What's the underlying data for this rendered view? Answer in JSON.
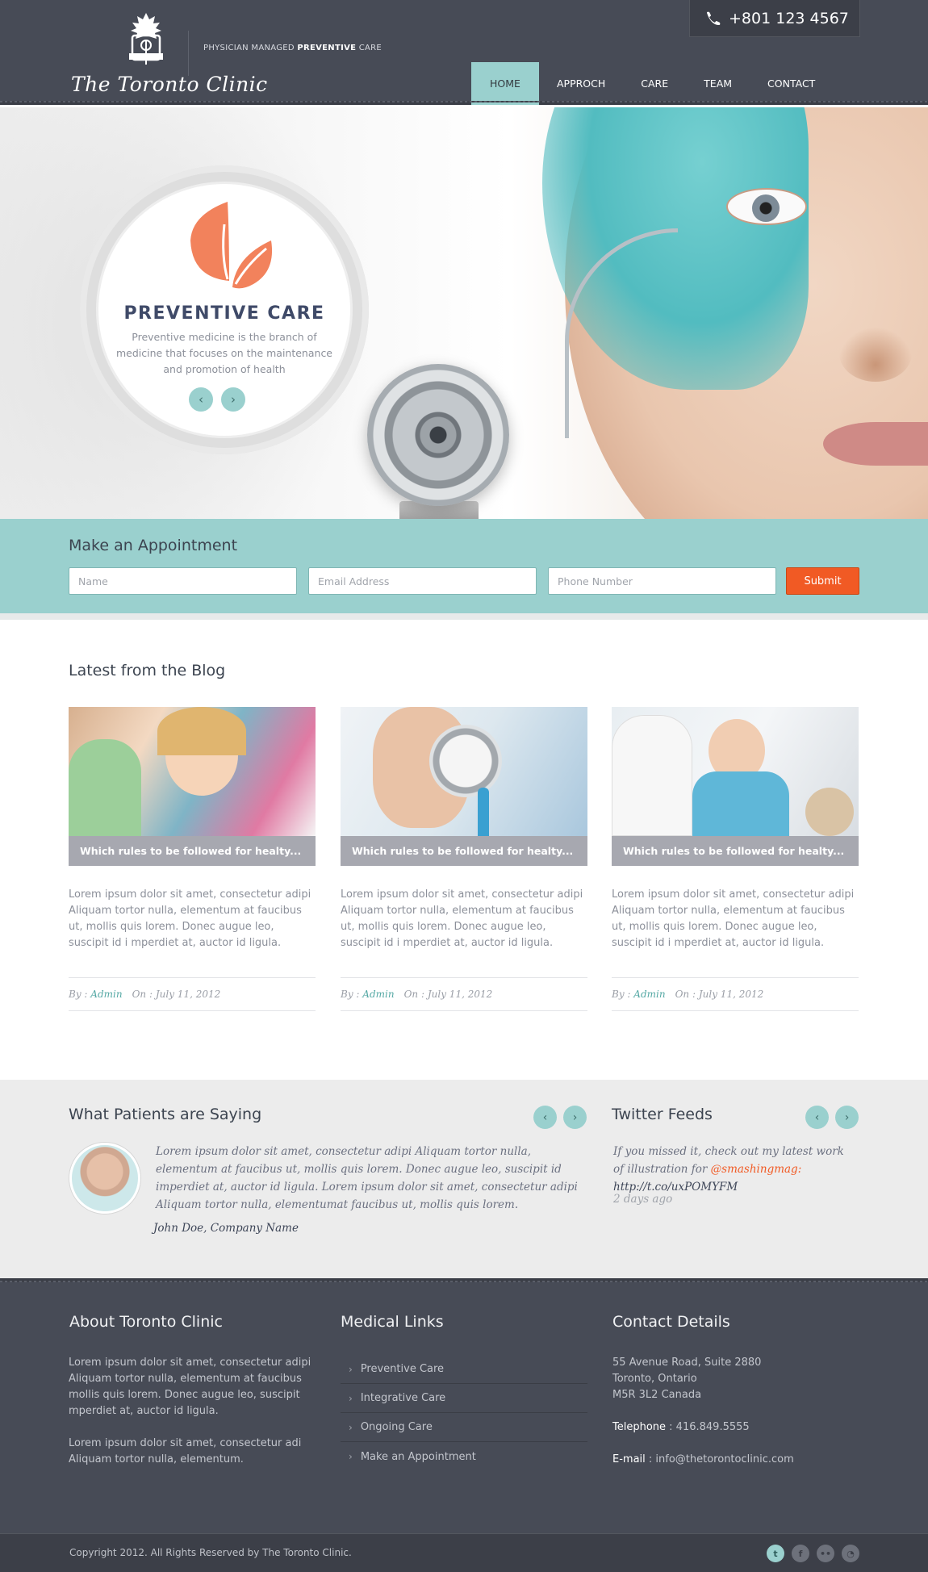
{
  "brand": {
    "logo_text": "The Toronto Clinic",
    "tagline_pre": "Physician managed ",
    "tagline_bold": "preventive",
    "tagline_post": " care",
    "phone": "+801 123 4567"
  },
  "nav": {
    "items": [
      {
        "label": "HOME",
        "active": true
      },
      {
        "label": "APPROCH"
      },
      {
        "label": "CARE"
      },
      {
        "label": "TEAM"
      },
      {
        "label": "CONTACT"
      }
    ]
  },
  "hero": {
    "slide_title": "PREVENTIVE CARE",
    "slide_text": "Preventive medicine is the branch of medicine that focuses on the maintenance and promotion of health",
    "prev_icon": "‹",
    "next_icon": "›",
    "feature_icons": [
      "plant-icon",
      "microscope-icon",
      "group-icon"
    ]
  },
  "appointment": {
    "title": "Make an Appointment",
    "name_placeholder": "Name",
    "email_placeholder": "Email Address",
    "phone_placeholder": "Phone Number",
    "submit_label": "Submit"
  },
  "blog": {
    "title": "Latest from the Blog",
    "posts": [
      {
        "caption": "Which rules to be followed for healty...",
        "text": "Lorem ipsum dolor sit amet, consectetur adipi Aliquam tortor nulla, elementum at faucibus ut, mollis quis lorem. Donec augue leo, suscipit id i mperdiet at, auctor id ligula.",
        "by_label": "By :",
        "author": "Admin",
        "on_label": "On : July 11, 2012"
      },
      {
        "caption": "Which rules to be followed for healty...",
        "text": "Lorem ipsum dolor sit amet, consectetur adipi Aliquam tortor nulla, elementum at faucibus ut, mollis quis lorem. Donec augue leo, suscipit id i mperdiet at, auctor id ligula.",
        "by_label": "By :",
        "author": "Admin",
        "on_label": "On : July 11, 2012"
      },
      {
        "caption": "Which rules to be followed for healty...",
        "text": "Lorem ipsum dolor sit amet, consectetur adipi Aliquam tortor nulla, elementum at faucibus ut, mollis quis lorem. Donec augue leo, suscipit id i mperdiet at, auctor id ligula.",
        "by_label": "By :",
        "author": "Admin",
        "on_label": "On : July 11, 2012"
      }
    ]
  },
  "patients": {
    "title": "What Patients are Saying",
    "quote": "Lorem ipsum dolor sit amet, consectetur adipi Aliquam tortor nulla, elementum at faucibus ut, mollis quis lorem. Donec augue leo, suscipit id imperdiet at, auctor id ligula. Lorem ipsum dolor sit amet, consectetur adipi Aliquam tortor nulla, elementumat faucibus ut, mollis quis lorem.",
    "author": "John Doe, Company Name"
  },
  "twitter": {
    "title": "Twitter Feeds",
    "tweet_pre": "If you missed it, check out my latest work of illustration for ",
    "mention": "@smashingmag:",
    "link": "http://t.co/uxPOMYFM",
    "time": "2 days ago"
  },
  "footer": {
    "about_title": "About Toronto Clinic",
    "about_p1": "Lorem ipsum dolor sit amet, consectetur adipi Aliquam tortor nulla, elementum at faucibus mollis quis lorem. Donec augue leo, suscipit mperdiet at, auctor id ligula.",
    "about_p2": "Lorem ipsum dolor sit amet, consectetur adi Aliquam tortor nulla, elementum.",
    "links_title": "Medical Links",
    "links": [
      "Preventive Care",
      "Integrative Care",
      "Ongoing Care",
      "Make an Appointment"
    ],
    "contact_title": "Contact Details",
    "address_1": "55 Avenue Road, Suite 2880",
    "address_2": "Toronto, Ontario",
    "address_3": "M5R 3L2 Canada",
    "telephone_label": "Telephone",
    "telephone_value": ": 416.849.5555",
    "email_label": "E-mail",
    "email_value": ": info@thetorontoclinic.com",
    "copyright": "Copyright 2012. All Rights Reserved by The Toronto Clinic."
  },
  "socials": [
    "twitter-icon",
    "facebook-icon",
    "flickr-icon",
    "rss-icon"
  ],
  "colors": {
    "accent": "#9ad0ce",
    "orange": "#f15a24",
    "dark": "#474b56",
    "navy": "#3f4a68"
  }
}
